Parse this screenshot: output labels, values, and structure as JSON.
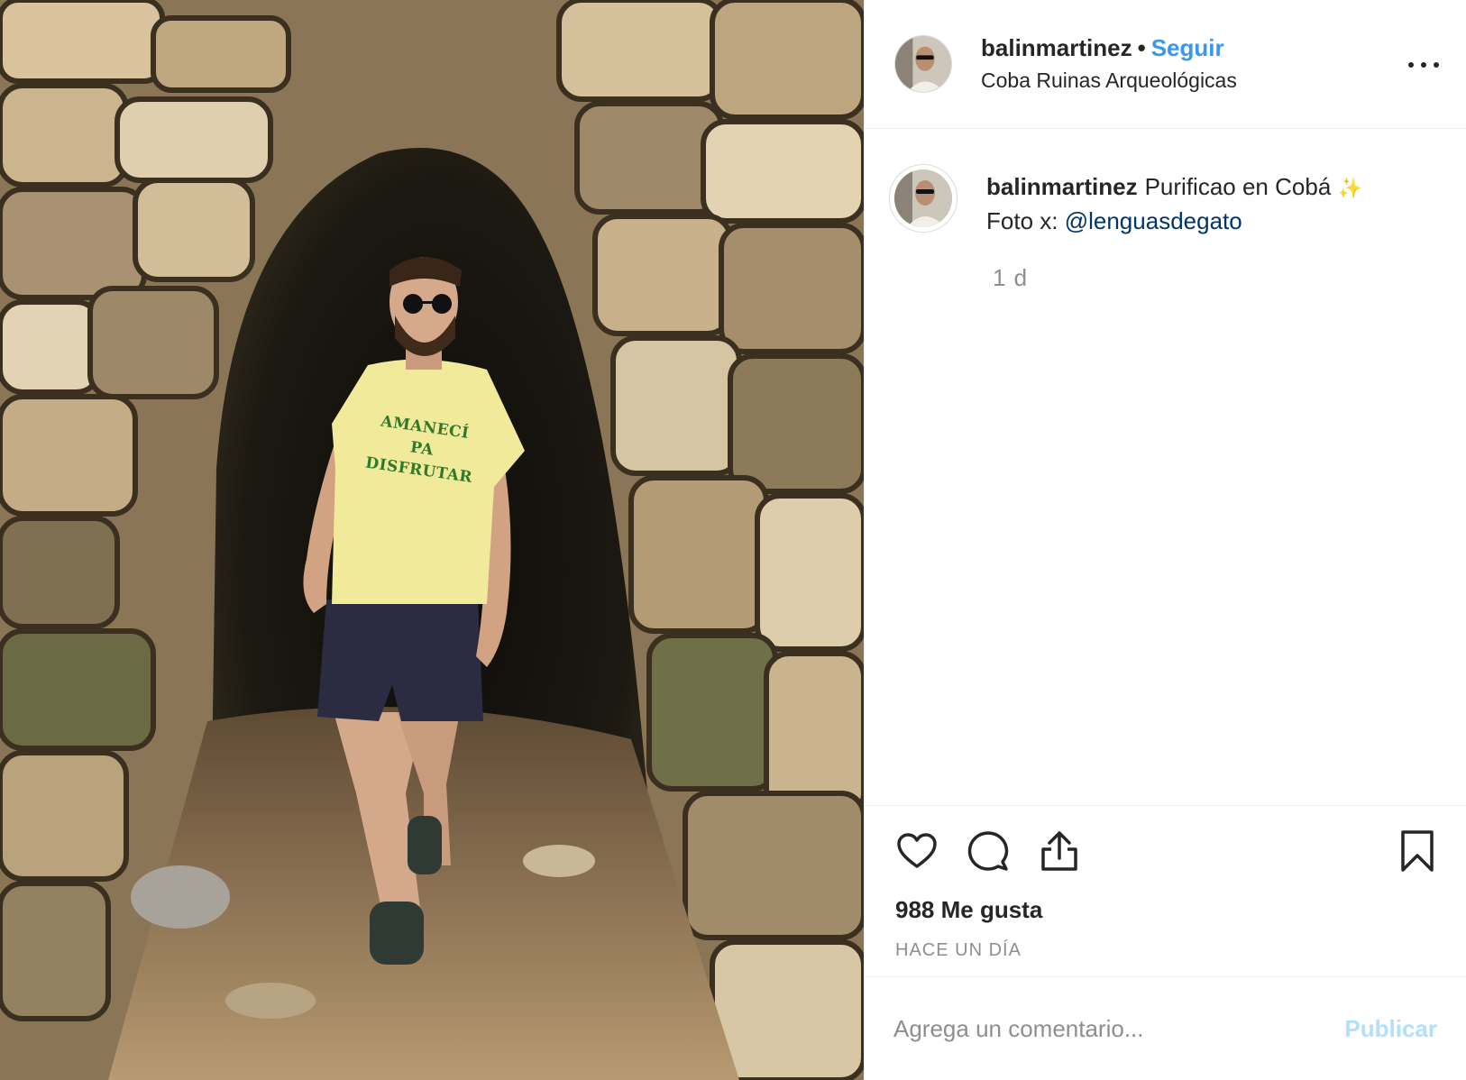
{
  "post": {
    "photo_alt": "photo",
    "shirt_text": "AMANECÍ PA DISFRUTAR"
  },
  "header": {
    "username": "balinmartinez",
    "separator": "•",
    "follow_label": "Seguir",
    "location": "Coba Ruinas Arqueológicas"
  },
  "caption": {
    "username": "balinmartinez",
    "text_line1": "Purificao en Cobá",
    "sparkle": "✨",
    "text_line2_prefix": "Foto x:",
    "mention": "@lenguasdegato",
    "time_ago": "1 d"
  },
  "actions": {
    "likes": "988 Me gusta",
    "timestamp": "HACE UN DÍA"
  },
  "comment": {
    "placeholder": "Agrega un comentario...",
    "publish_label": "Publicar"
  },
  "colors": {
    "link_blue": "#3897f0",
    "mention_blue": "#003569",
    "disabled_blue": "#b2dffc",
    "muted_gray": "#8e8e8e",
    "text": "#262626"
  },
  "icons": [
    "heart-icon",
    "comment-icon",
    "share-icon",
    "bookmark-icon",
    "more-icon"
  ]
}
